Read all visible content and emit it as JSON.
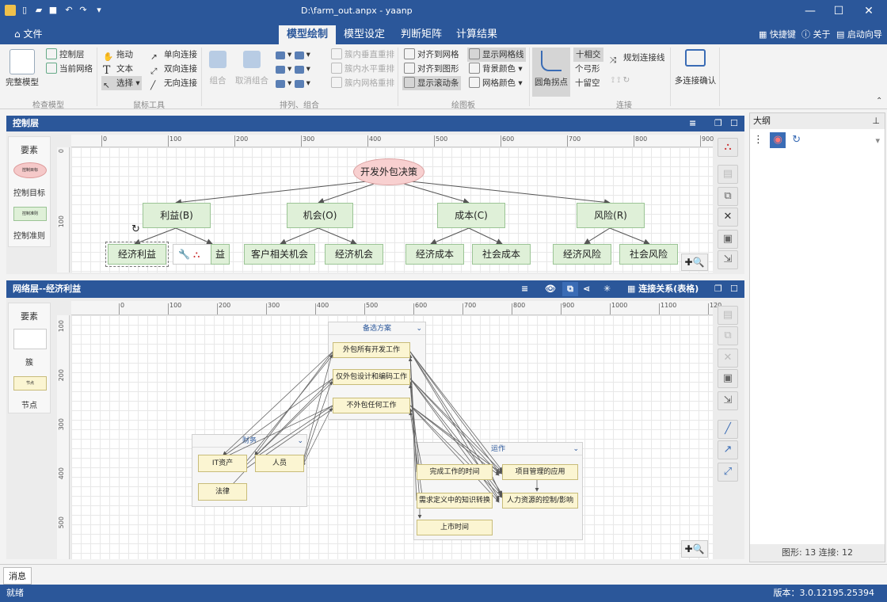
{
  "window": {
    "title": "D:\\farm_out.anpx - yaanp"
  },
  "menu": {
    "file": "文件",
    "tabs": [
      {
        "label": "模型绘制",
        "active": true
      },
      {
        "label": "模型设定",
        "active": false
      },
      {
        "label": "判断矩阵",
        "active": false
      },
      {
        "label": "计算结果",
        "active": false
      }
    ],
    "right": {
      "shortcut": "快捷键",
      "about": "关于",
      "wizard": "启动向导"
    }
  },
  "ribbon": {
    "check": {
      "complete_model": "完整模型",
      "control_layer": "控制层",
      "current_network": "当前网络",
      "group": "检查模型"
    },
    "mouse": {
      "drag": "拖动",
      "text": "文本",
      "select": "选择",
      "one_way": "单向连接",
      "two_way": "双向连接",
      "no_way": "无向连接",
      "group": "鼠标工具"
    },
    "arrange": {
      "combine": "组合",
      "uncombine": "取消组合",
      "vertical": "簇内垂直重排",
      "horizontal": "簇内水平重排",
      "grid": "簇内网格重排",
      "group": "排列、组合"
    },
    "canvas": {
      "align_grid": "对齐到网格",
      "align_shape": "对齐到图形",
      "show_scroll": "显示滚动条",
      "show_grid": "显示网格线",
      "bg_color": "背景颜色",
      "grid_color": "网格颜色",
      "group": "绘图板"
    },
    "connect": {
      "round_corner": "圆角拐点",
      "cross": "十相交",
      "arc": "个弓形",
      "gap": "十留空",
      "plan": "规划连接线",
      "multi_confirm": "多连接确认",
      "group": "连接"
    }
  },
  "control_panel": {
    "title": "控制层",
    "elements_label": "要素",
    "items": [
      {
        "thumb": "控制目标",
        "label": "控制目标"
      },
      {
        "thumb": "控制准则",
        "label": "控制准则"
      }
    ],
    "ruler_ticks": [
      "0",
      "100",
      "200",
      "300",
      "400",
      "500",
      "600",
      "700",
      "800",
      "900"
    ],
    "ruler_ticks_v": [
      "0",
      "100"
    ],
    "goal": "开发外包决策",
    "criteria": [
      "利益(B)",
      "机会(O)",
      "成本(C)",
      "风险(R)"
    ],
    "subcriteria": [
      "经济利益",
      "益",
      "客户相关机会",
      "经济机会",
      "经济成本",
      "社会成本",
      "经济风险",
      "社会风险"
    ]
  },
  "network_panel": {
    "title": "网络层--经济利益",
    "link_table": "连接关系(表格)",
    "elements_label": "要素",
    "items": [
      {
        "thumb": "",
        "label": "簇"
      },
      {
        "thumb": "节点",
        "label": "节点"
      }
    ],
    "ruler_ticks": [
      "0",
      "100",
      "200",
      "300",
      "400",
      "500",
      "600",
      "700",
      "800",
      "900",
      "1000",
      "1100",
      "120"
    ],
    "ruler_ticks_v": [
      "100",
      "200",
      "300",
      "400",
      "500"
    ],
    "clusters": {
      "alternatives": {
        "name": "备选方案",
        "nodes": [
          "外包所有开发工作",
          "仅外包设计和编码工作",
          "不外包任何工作"
        ]
      },
      "finance": {
        "name": "财务",
        "nodes": [
          "IT资产",
          "人员",
          "法律"
        ]
      },
      "operations": {
        "name": "运作",
        "nodes": [
          "完成工作的时间",
          "项目管理的应用",
          "需求定义中的知识转换",
          "人力资源的控制/影响",
          "上市时间"
        ]
      }
    }
  },
  "outline": {
    "title": "大纲",
    "stats": "图形: 13  连接: 12"
  },
  "message_tab": "消息",
  "status": {
    "left": "就绪",
    "version": "版本：3.0.12195.25394"
  }
}
